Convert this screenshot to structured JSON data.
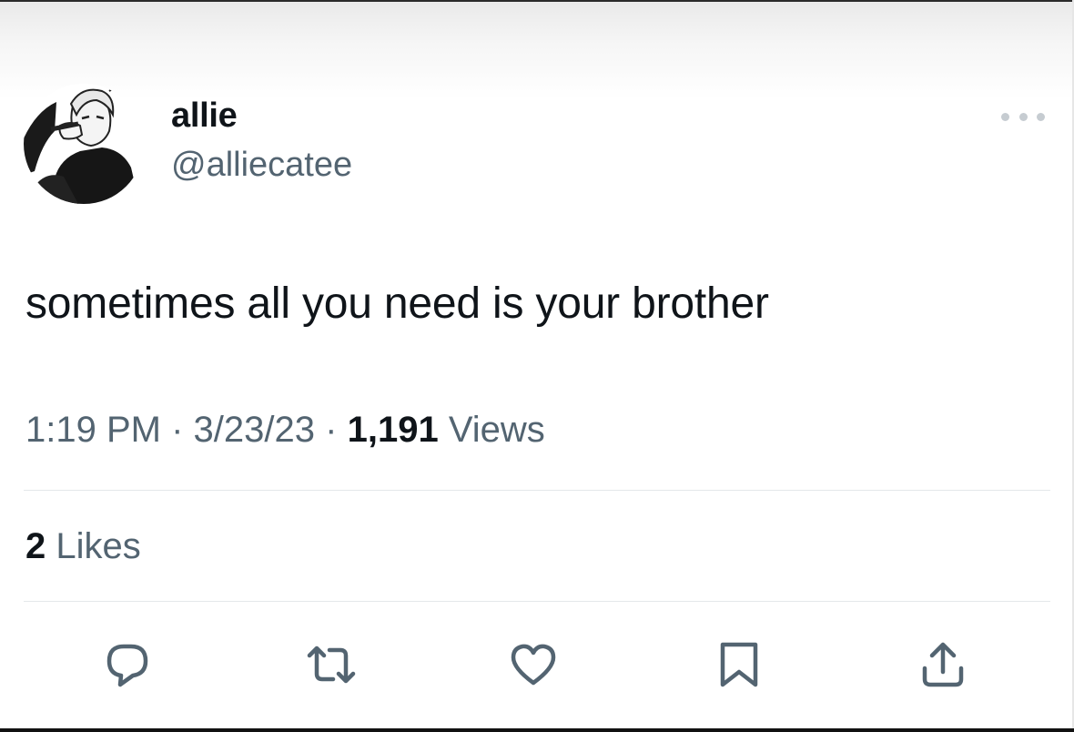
{
  "tweet": {
    "author_name": "allie",
    "author_handle": "@alliecatee",
    "text": "sometimes all you need is your brother",
    "time": "1:19 PM",
    "separator": "·",
    "date": "3/23/23",
    "views_count": "1,191",
    "views_label": "Views",
    "likes_count": "2",
    "likes_label": "Likes"
  },
  "icons": {
    "more": "more-horizontal-icon",
    "reply": "reply-icon",
    "retweet": "retweet-icon",
    "like": "heart-icon",
    "bookmark": "bookmark-icon",
    "share": "share-icon"
  },
  "colors": {
    "text_primary": "#0f1419",
    "text_secondary": "#536471",
    "divider": "#e4e8ea",
    "icon": "#536471"
  }
}
